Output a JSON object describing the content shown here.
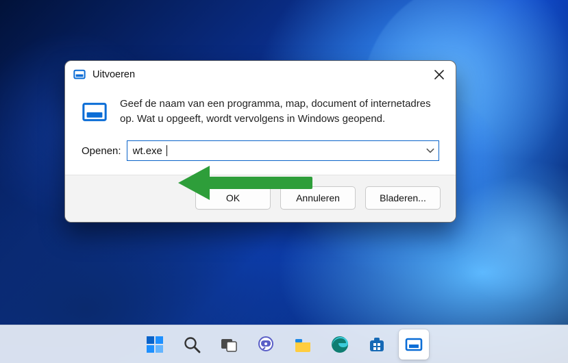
{
  "dialog": {
    "title": "Uitvoeren",
    "description": "Geef de naam van een programma, map, document of internetadres op. Wat u opgeeft, wordt vervolgens in Windows geopend.",
    "open_label": "Openen:",
    "input_value": "wt.exe",
    "buttons": {
      "ok": "OK",
      "cancel": "Annuleren",
      "browse": "Bladeren..."
    }
  },
  "taskbar": {
    "items": [
      {
        "name": "start"
      },
      {
        "name": "search"
      },
      {
        "name": "task-view"
      },
      {
        "name": "chat"
      },
      {
        "name": "file-explorer"
      },
      {
        "name": "edge"
      },
      {
        "name": "microsoft-store"
      },
      {
        "name": "run",
        "active": true
      }
    ]
  },
  "colors": {
    "accent": "#0b6dd6",
    "arrow": "#2e9e3a"
  }
}
